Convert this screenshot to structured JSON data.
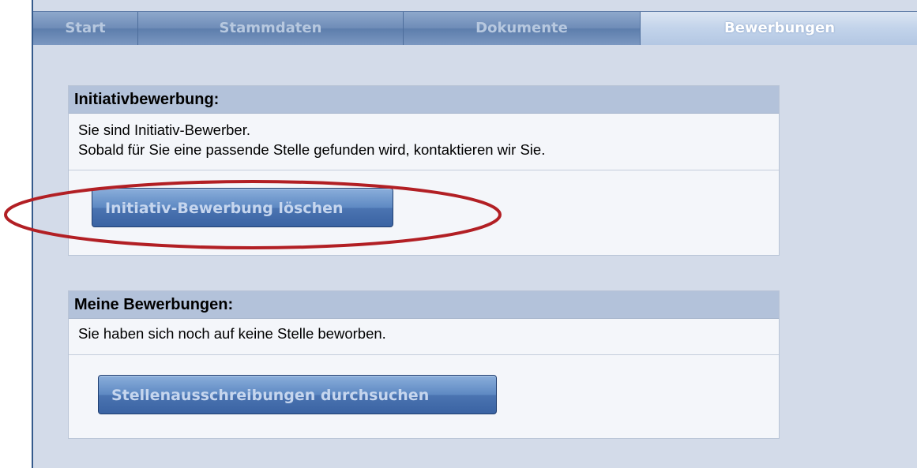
{
  "tabs": [
    {
      "label": "Start",
      "active": false
    },
    {
      "label": "Stammdaten",
      "active": false
    },
    {
      "label": "Dokumente",
      "active": false
    },
    {
      "label": "Bewerbungen",
      "active": true
    }
  ],
  "initiative": {
    "heading": "Initiativbewerbung:",
    "line1": "Sie sind Initiativ-Bewerber.",
    "line2": "Sobald für Sie eine passende Stelle gefunden wird, kontaktieren wir Sie.",
    "button_label": "Initiativ-Bewerbung löschen"
  },
  "applications": {
    "heading": "Meine Bewerbungen:",
    "line1": "Sie haben sich noch auf keine Stelle beworben.",
    "button_label": "Stellenausschreibungen durchsuchen"
  },
  "colors": {
    "annotation": "#b21f24",
    "tab_bar": "#6f8db8",
    "panel_header": "#b3c2da",
    "button": "#4b74b1"
  }
}
